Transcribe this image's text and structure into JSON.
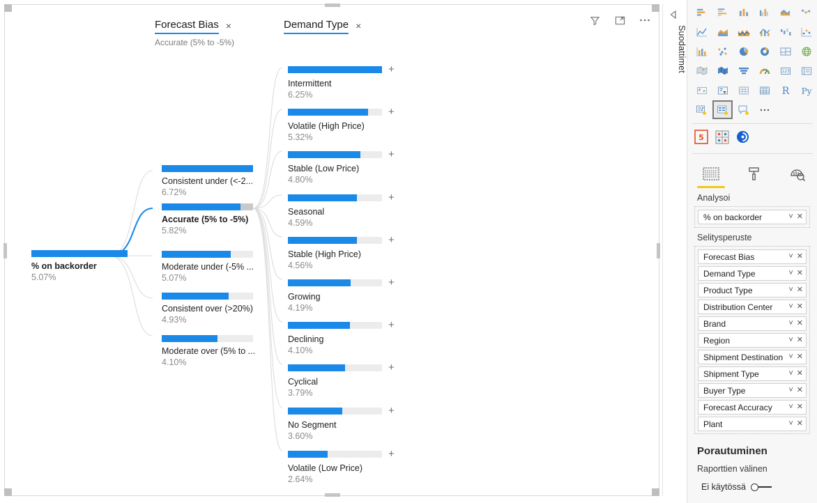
{
  "visual_header": {
    "filter_icon": "filter-funnel-icon",
    "focus_icon": "focus-mode-icon",
    "more_icon": "more-options-icon"
  },
  "filters_pane": {
    "label": "Suodattimet",
    "collapse_icon": "collapse-arrow-icon"
  },
  "tree": {
    "levels": [
      {
        "name": "Forecast Bias",
        "subtitle": "Accurate (5% to -5%)",
        "close_label": "×"
      },
      {
        "name": "Demand Type",
        "subtitle": "",
        "close_label": "×"
      }
    ],
    "root": {
      "label": "% on backorder",
      "value": "5.07%",
      "ratio": 1.0,
      "selected": true
    },
    "forecast_bias": [
      {
        "label": "Consistent under (<-2...",
        "value": "6.72%",
        "ratio": 1.0,
        "tail": 0.0,
        "selected": false
      },
      {
        "label": "Accurate (5% to -5%)",
        "value": "5.82%",
        "ratio": 0.866,
        "tail": 0.134,
        "selected": true
      },
      {
        "label": "Moderate under (-5% ...",
        "value": "5.07%",
        "ratio": 0.754,
        "tail": 0.0,
        "selected": false
      },
      {
        "label": "Consistent over (>20%)",
        "value": "4.93%",
        "ratio": 0.733,
        "tail": 0.0,
        "selected": false
      },
      {
        "label": "Moderate over (5% to ...",
        "value": "4.10%",
        "ratio": 0.61,
        "tail": 0.0,
        "selected": false
      }
    ],
    "demand_type": [
      {
        "label": "Intermittent",
        "value": "6.25%",
        "ratio": 1.0
      },
      {
        "label": "Volatile (High Price)",
        "value": "5.32%",
        "ratio": 0.851
      },
      {
        "label": "Stable (Low Price)",
        "value": "4.80%",
        "ratio": 0.768
      },
      {
        "label": "Seasonal",
        "value": "4.59%",
        "ratio": 0.734
      },
      {
        "label": "Stable (High Price)",
        "value": "4.56%",
        "ratio": 0.73
      },
      {
        "label": "Growing",
        "value": "4.19%",
        "ratio": 0.67
      },
      {
        "label": "Declining",
        "value": "4.10%",
        "ratio": 0.656
      },
      {
        "label": "Cyclical",
        "value": "3.79%",
        "ratio": 0.606
      },
      {
        "label": "No Segment",
        "value": "3.60%",
        "ratio": 0.576
      },
      {
        "label": "Volatile (Low Price)",
        "value": "2.64%",
        "ratio": 0.422
      }
    ],
    "expand_icon": "plus-icon"
  },
  "right_pane": {
    "gallery_icons": [
      "stacked-bar-chart-icon",
      "clustered-bar-chart-icon",
      "stacked-column-chart-icon",
      "clustered-column-chart-icon",
      "stacked-area-chart-icon",
      "ribbon-chart-icon",
      "line-chart-icon",
      "area-chart-icon",
      "line-stacked-column-icon",
      "line-clustered-column-icon",
      "waterfall-chart-icon",
      "scatter-chart-icon",
      "combo-chart-icon",
      "dot-plot-icon",
      "pie-chart-icon",
      "donut-chart-icon",
      "treemap-icon",
      "globe-map-icon",
      "filled-map-icon",
      "shape-map-icon",
      "funnel-chart-icon",
      "gauge-chart-icon",
      "card-icon",
      "multi-row-card-icon",
      "kpi-icon",
      "slicer-icon",
      "table-icon",
      "matrix-icon",
      "r-script-visual-icon",
      "python-visual-icon",
      "key-influencers-icon",
      "decomposition-tree-icon",
      "qna-visual-icon",
      "more-visuals-icon"
    ],
    "selected_gallery_icon": "decomposition-tree-icon",
    "custom_icons": [
      "html5-visual-icon",
      "grid-visual-icon",
      "power-visual-icon"
    ],
    "pane_tabs": [
      {
        "icon": "fields-pane-icon",
        "active": true
      },
      {
        "icon": "format-pane-icon",
        "active": false
      },
      {
        "icon": "analytics-pane-icon",
        "active": false
      }
    ],
    "analyze_label": "Analysoi",
    "analyze_field": {
      "name": "% on backorder",
      "chevron": "chevron-down-icon",
      "remove": "remove-icon"
    },
    "explain_by_label": "Selitysperuste",
    "explain_by_fields": [
      "Forecast Bias",
      "Demand Type",
      "Product Type",
      "Distribution Center",
      "Brand",
      "Region",
      "Shipment Destination",
      "Shipment Type",
      "Buyer Type",
      "Forecast Accuracy",
      "Plant"
    ],
    "field_chevron": "chevron-down-icon",
    "field_remove": "remove-icon",
    "drill": {
      "title": "Porautuminen",
      "subtitle": "Raporttien välinen",
      "toggle_label": "Ei käytössä",
      "toggle_state": "off"
    }
  },
  "colors": {
    "accent_blue": "#1a89e8",
    "bar_track": "#ececec",
    "bar_tail": "#c9c9c9",
    "pane_bg": "#f7f7f7",
    "tab_underline": "#f2c811"
  }
}
